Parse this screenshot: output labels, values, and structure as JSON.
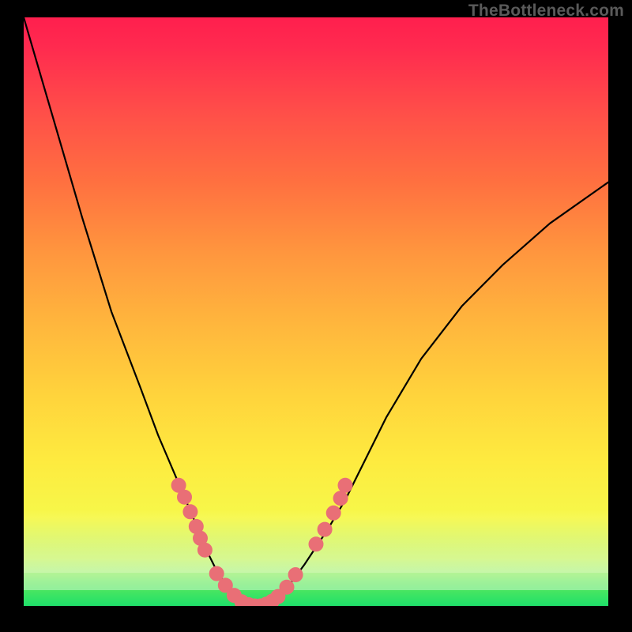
{
  "watermark": "TheBottleneck.com",
  "chart_data": {
    "type": "line",
    "title": "",
    "xlabel": "",
    "ylabel": "",
    "x_range": [
      0,
      100
    ],
    "y_range": [
      0,
      100
    ],
    "grid": false,
    "legend": false,
    "series": [
      {
        "name": "curve",
        "x": [
          0,
          5,
          10,
          15,
          20,
          23,
          26,
          29,
          31,
          33,
          35,
          37,
          39,
          40,
          42,
          45,
          48,
          52,
          55,
          58,
          62,
          68,
          75,
          82,
          90,
          100
        ],
        "y": [
          100,
          83,
          66,
          50,
          37,
          29,
          22,
          15,
          10,
          6,
          3,
          1,
          0,
          0,
          1,
          3,
          7,
          13,
          18,
          24,
          32,
          42,
          51,
          58,
          65,
          72
        ]
      }
    ],
    "markers": {
      "name": "highlighted-points",
      "color": "#e96f76",
      "x": [
        26.5,
        27.5,
        28.5,
        29.5,
        30.2,
        31.0,
        33.0,
        34.5,
        36.0,
        37.3,
        38.5,
        39.5,
        40.5,
        41.5,
        42.5,
        43.5,
        45.0,
        46.5,
        50.0,
        51.5,
        53.0,
        54.2,
        55.0
      ],
      "y": [
        20.5,
        18.5,
        16.0,
        13.5,
        11.5,
        9.5,
        5.5,
        3.5,
        1.8,
        0.7,
        0.2,
        0.0,
        0.0,
        0.3,
        0.8,
        1.6,
        3.2,
        5.3,
        10.5,
        13.0,
        15.8,
        18.3,
        20.5
      ]
    },
    "background_gradient": {
      "bottom": "#1fe06a",
      "mid": "#feea3f",
      "top": "#ff1f4e"
    }
  }
}
